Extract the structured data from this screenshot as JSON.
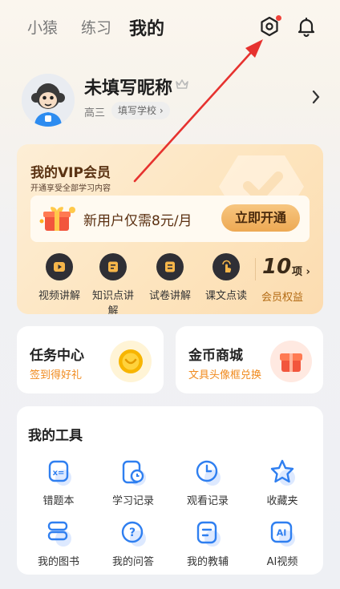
{
  "tabs": [
    {
      "label": "小猿",
      "active": false
    },
    {
      "label": "练习",
      "active": false
    },
    {
      "label": "我的",
      "active": true
    }
  ],
  "icons": {
    "settings": "settings-gear-icon",
    "notification": "bell-icon"
  },
  "profile": {
    "nickname": "未填写昵称",
    "grade": "高三",
    "school": "填写学校 ›"
  },
  "vip": {
    "title": "我的VIP会员",
    "subtitle": "开通享受全部学习内容",
    "offer": "新用户仅需8元/月",
    "open_button": "立即开通",
    "features": [
      {
        "label": "视频讲解",
        "icon": "play-icon"
      },
      {
        "label": "知识点讲解",
        "icon": "doc-icon"
      },
      {
        "label": "试卷讲解",
        "icon": "paper-icon"
      },
      {
        "label": "课文点读",
        "icon": "tap-icon"
      }
    ],
    "benefits_count": "10",
    "benefits_unit": "项 ›",
    "benefits_label": "会员权益"
  },
  "task_center": {
    "title": "任务中心",
    "subtitle": "签到得好礼"
  },
  "coin_mall": {
    "title": "金币商城",
    "subtitle": "文具头像框兑换"
  },
  "tools": {
    "title": "我的工具",
    "items": [
      {
        "label": "错题本",
        "icon": "wrong-book-icon"
      },
      {
        "label": "学习记录",
        "icon": "study-record-icon"
      },
      {
        "label": "观看记录",
        "icon": "clock-icon"
      },
      {
        "label": "收藏夹",
        "icon": "star-icon"
      },
      {
        "label": "我的图书",
        "icon": "books-icon"
      },
      {
        "label": "我的问答",
        "icon": "question-icon"
      },
      {
        "label": "我的教辅",
        "icon": "tutorial-book-icon"
      },
      {
        "label": "AI视频",
        "icon": "ai-video-icon"
      }
    ]
  },
  "colors": {
    "accent_orange": "#f08a1e",
    "tool_blue": "#2f7ff0",
    "arrow_red": "#e6322f"
  }
}
